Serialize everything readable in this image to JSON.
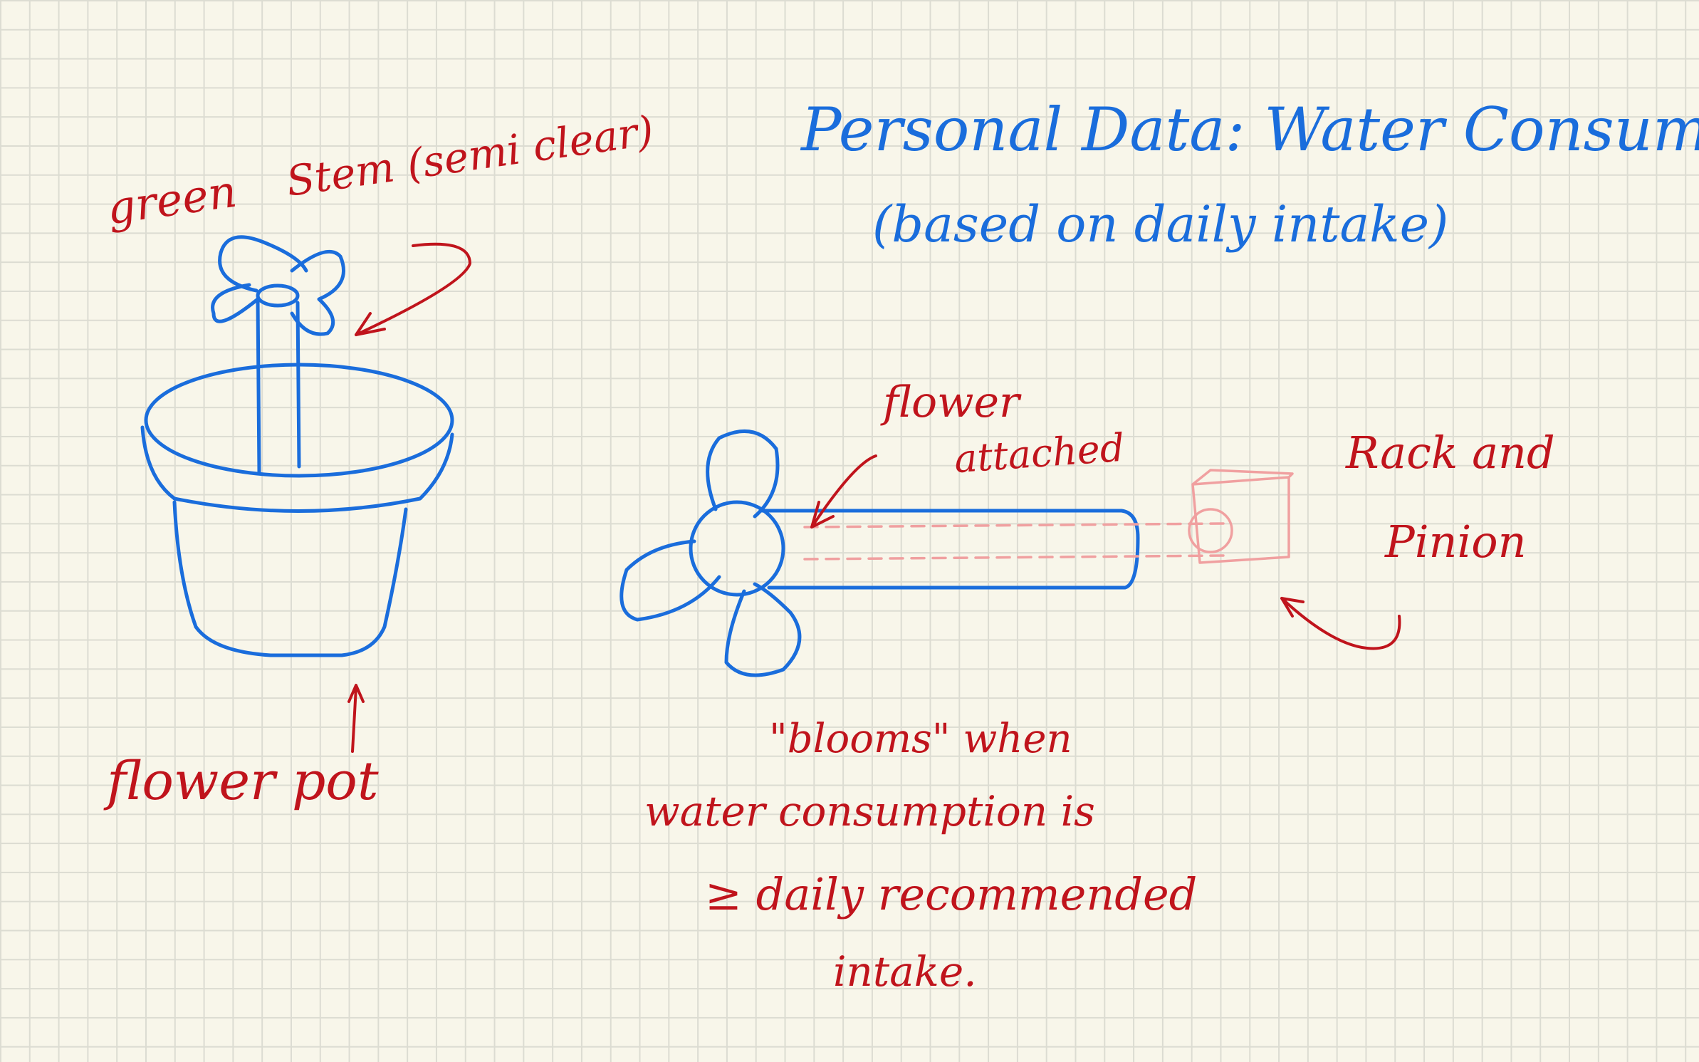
{
  "title": "Personal Data: Water Consumption",
  "subtitle": "(based on daily intake)",
  "labels": {
    "green": "green",
    "stem": "Stem (semi clear)",
    "flower_pot": "flower pot",
    "flower_attached_1": "flower",
    "flower_attached_2": "attached",
    "rack_1": "Rack and",
    "rack_2": "Pinion",
    "blooms_1": "\"blooms\" when",
    "blooms_2": "water consumption is",
    "blooms_3": "≥ daily recommended",
    "blooms_4": "intake."
  },
  "colors": {
    "paper": "#f8f6ea",
    "grid": "#dcdcd2",
    "blue_ink": "#1a6ddc",
    "red_ink": "#c0141c",
    "pink_ink": "#f0a0a0"
  }
}
